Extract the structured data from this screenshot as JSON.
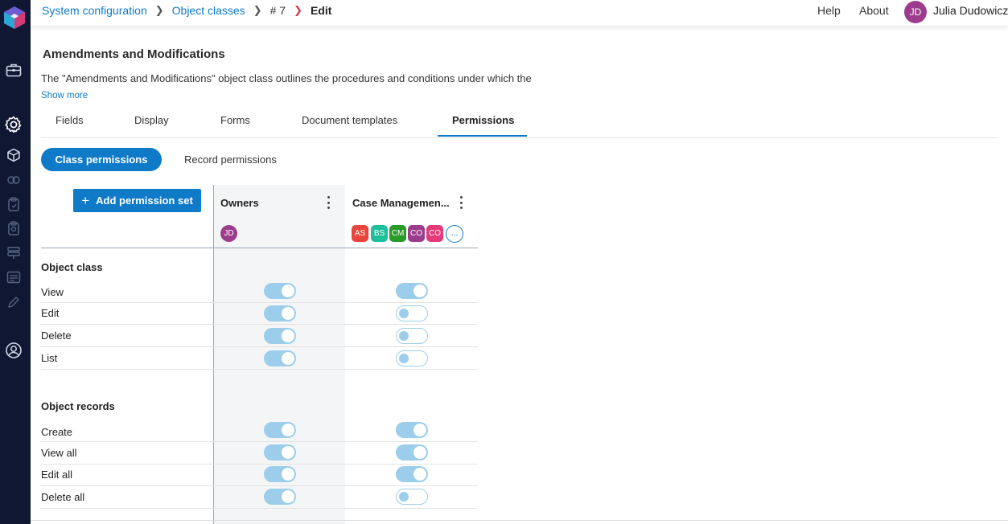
{
  "breadcrumbs": {
    "items": [
      "System configuration",
      "Object classes",
      "# 7",
      "Edit"
    ]
  },
  "topnav": {
    "help": "Help",
    "about": "About",
    "user_initials": "JD",
    "user_name": "Julia Dudowicz"
  },
  "header": {
    "title": "Amendments and Modifications",
    "description": "The \"Amendments and Modifications\" object class outlines the procedures and conditions under which the",
    "show_more": "Show more"
  },
  "tabs": [
    "Fields",
    "Display",
    "Forms",
    "Document templates",
    "Permissions"
  ],
  "active_tab": "Permissions",
  "subtabs": {
    "class_permissions": "Class permissions",
    "record_permissions": "Record permissions"
  },
  "permissions": {
    "add_button": "Add permission set",
    "columns": [
      {
        "name": "Owners",
        "members": [
          {
            "initials": "JD",
            "color": "#9c3c8c"
          }
        ]
      },
      {
        "name": "Case Managemen...",
        "members": [
          {
            "initials": "AS",
            "color": "#e8463c"
          },
          {
            "initials": "BS",
            "color": "#1fbf9b"
          },
          {
            "initials": "CM",
            "color": "#2a9a2a"
          },
          {
            "initials": "CO",
            "color": "#9c3c8c"
          },
          {
            "initials": "CO",
            "color": "#e33a7a"
          }
        ],
        "more_label": "..."
      }
    ],
    "sections": [
      {
        "label": "Object class",
        "rows": [
          {
            "label": "View",
            "values": [
              true,
              true
            ]
          },
          {
            "label": "Edit",
            "values": [
              true,
              false
            ]
          },
          {
            "label": "Delete",
            "values": [
              true,
              false
            ]
          },
          {
            "label": "List",
            "values": [
              true,
              false
            ]
          }
        ]
      },
      {
        "label": "Object records",
        "rows": [
          {
            "label": "Create",
            "values": [
              true,
              true
            ]
          },
          {
            "label": "View all",
            "values": [
              true,
              true
            ]
          },
          {
            "label": "Edit all",
            "values": [
              true,
              true
            ]
          },
          {
            "label": "Delete all",
            "values": [
              true,
              false
            ]
          }
        ]
      }
    ]
  },
  "colors": {
    "accent": "#0f7ac8",
    "rail": "#0f1733",
    "toggle": "#9ccdea"
  }
}
